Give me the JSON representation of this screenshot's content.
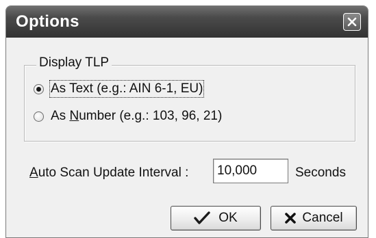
{
  "window": {
    "title": "Options"
  },
  "display_group": {
    "legend": "Display TLP",
    "options": [
      {
        "label": "As Text (e.g.: AIN 6-1, EU)",
        "selected": true
      },
      {
        "label_prefix": "As ",
        "label_mnemonic": "N",
        "label_suffix": "umber (e.g.: 103, 96, 21)",
        "selected": false
      }
    ]
  },
  "interval": {
    "label_mnemonic": "A",
    "label_rest": "uto Scan Update Interval :",
    "value": "10,000",
    "units": "Seconds"
  },
  "buttons": {
    "ok_label": "OK",
    "cancel_label": "Cancel"
  },
  "icons": {
    "close": "close-icon",
    "ok": "checkmark-icon",
    "cancel": "x-icon"
  }
}
